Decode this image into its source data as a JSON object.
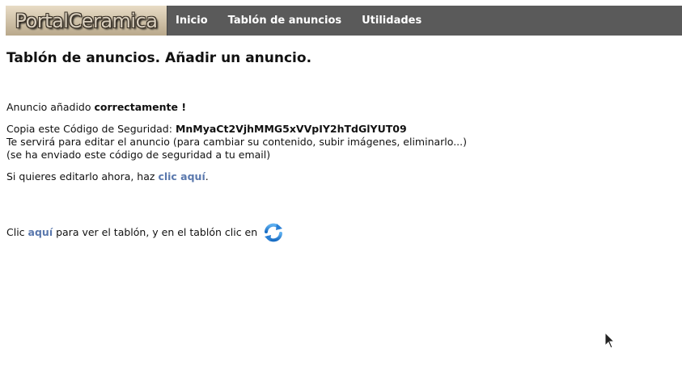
{
  "header": {
    "logo_text": "PortalCeramica",
    "nav": [
      {
        "label": "Inicio"
      },
      {
        "label": "Tablón de anuncios"
      },
      {
        "label": "Utilidades"
      }
    ]
  },
  "main": {
    "title": "Tablón de anuncios. Añadir un anuncio.",
    "added_prefix": "Anuncio añadido ",
    "added_strong": "correctamente !",
    "code_prefix": "Copia este Código de Seguridad: ",
    "code_value": "MnMyaCt2VjhMMG5xVVpIY2hTdGlYUT09",
    "code_line2": "Te servirá para editar el anuncio (para cambiar su contenido, subir imágenes, eliminarlo...)",
    "code_line3": "(se ha enviado este código de seguridad a tu email)",
    "edit_prefix": "Si quieres editarlo ahora, haz ",
    "edit_link": "clic aquí",
    "edit_suffix": ".",
    "view_prefix": "Clic ",
    "view_link": "aquí",
    "view_suffix": " para ver el tablón, y en el tablón clic en",
    "refresh_icon": "refresh-icon"
  },
  "colors": {
    "nav_bg": "#5a5a5a",
    "link": "#5a78ad",
    "refresh_blue": "#2a7fd4"
  }
}
